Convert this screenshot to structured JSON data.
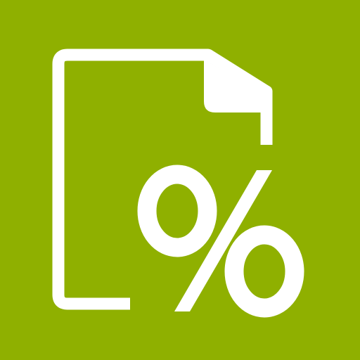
{
  "icon": {
    "name": "document-percent-icon",
    "background_color": "#8fb000",
    "foreground_color": "#ffffff"
  },
  "symbol": {
    "glyph": "%"
  }
}
